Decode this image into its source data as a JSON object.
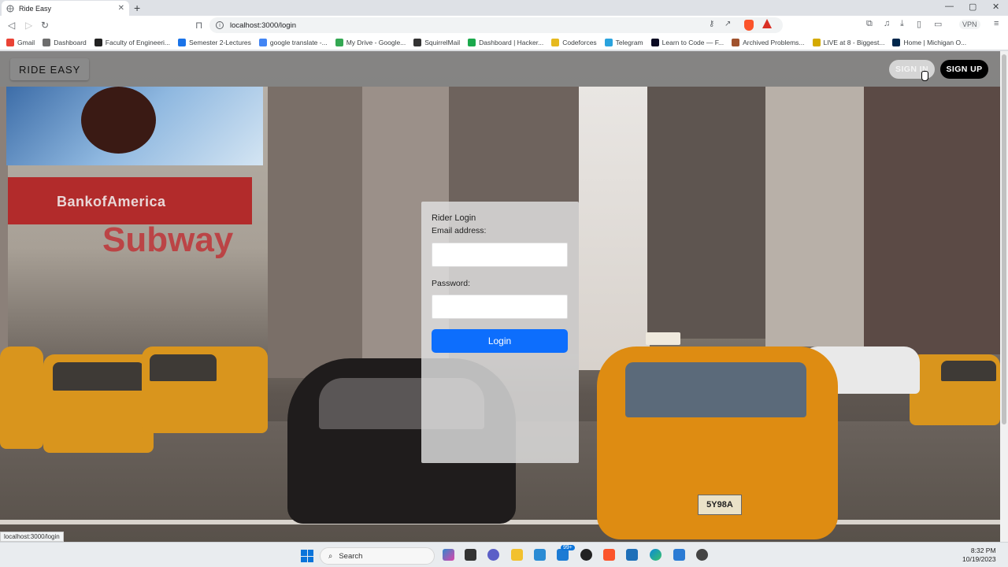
{
  "browser": {
    "tab_title": "Ride Easy",
    "tab_close": "✕",
    "new_tab": "+",
    "url": "localhost:3000/login",
    "vpn_label": "VPN",
    "bookmarks": [
      {
        "label": "Gmail",
        "color": "#ea4335"
      },
      {
        "label": "Dashboard",
        "color": "#6d6d6d"
      },
      {
        "label": "Faculty of Engineeri...",
        "color": "#222222"
      },
      {
        "label": "Semester 2-Lectures",
        "color": "#1a73e8"
      },
      {
        "label": "google translate -...",
        "color": "#4285f4"
      },
      {
        "label": "My Drive - Google...",
        "color": "#34a853"
      },
      {
        "label": "SquirrelMail",
        "color": "#333333"
      },
      {
        "label": "Dashboard | Hacker...",
        "color": "#1ba94c"
      },
      {
        "label": "Codeforces",
        "color": "#e6b91e"
      },
      {
        "label": "Telegram",
        "color": "#2aa3de"
      },
      {
        "label": "Learn to Code — F...",
        "color": "#0a0a23"
      },
      {
        "label": "Archived Problems...",
        "color": "#a0522d"
      },
      {
        "label": "LIVE at 8 - Biggest...",
        "color": "#d4aa00"
      },
      {
        "label": "Home | Michigan O...",
        "color": "#00274c"
      }
    ],
    "status_url": "localhost:3000/login"
  },
  "app": {
    "brand": "RIDE EASY",
    "signin_label": "SIGN IN",
    "signup_label": "SIGN UP",
    "bg_billboard_text": "BankofAmerica",
    "bg_subway_text": "Subway",
    "bg_plate_text": "5Y98A"
  },
  "login": {
    "title": "Rider Login",
    "email_label": "Email address:",
    "email_value": "",
    "password_label": "Password:",
    "password_value": "",
    "button_label": "Login"
  },
  "taskbar": {
    "search_label": "Search",
    "badge": "99+",
    "time": "8:32 PM",
    "date": "10/19/2023"
  }
}
